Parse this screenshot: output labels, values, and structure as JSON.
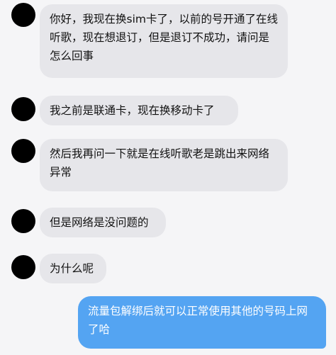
{
  "messages": [
    {
      "side": "left",
      "text": "你好，我现在换sim卡了，以前的号开通了在线听歌，现在想退订，但是退订不成功，请问是怎么回事"
    },
    {
      "side": "left",
      "text": "我之前是联通卡，现在换移动卡了"
    },
    {
      "side": "left",
      "text": "然后我再问一下就是在线听歌老是跳出来网络异常"
    },
    {
      "side": "left",
      "text": "但是网络是没问题的"
    },
    {
      "side": "left",
      "text": "为什么呢"
    },
    {
      "side": "right",
      "text": "流量包解绑后就可以正常使用其他的号码上网了哈"
    }
  ],
  "colors": {
    "background": "#f5f5f7",
    "bubble_left": "#e6e6ea",
    "bubble_right": "#54a4f2",
    "avatar": "#000000"
  }
}
